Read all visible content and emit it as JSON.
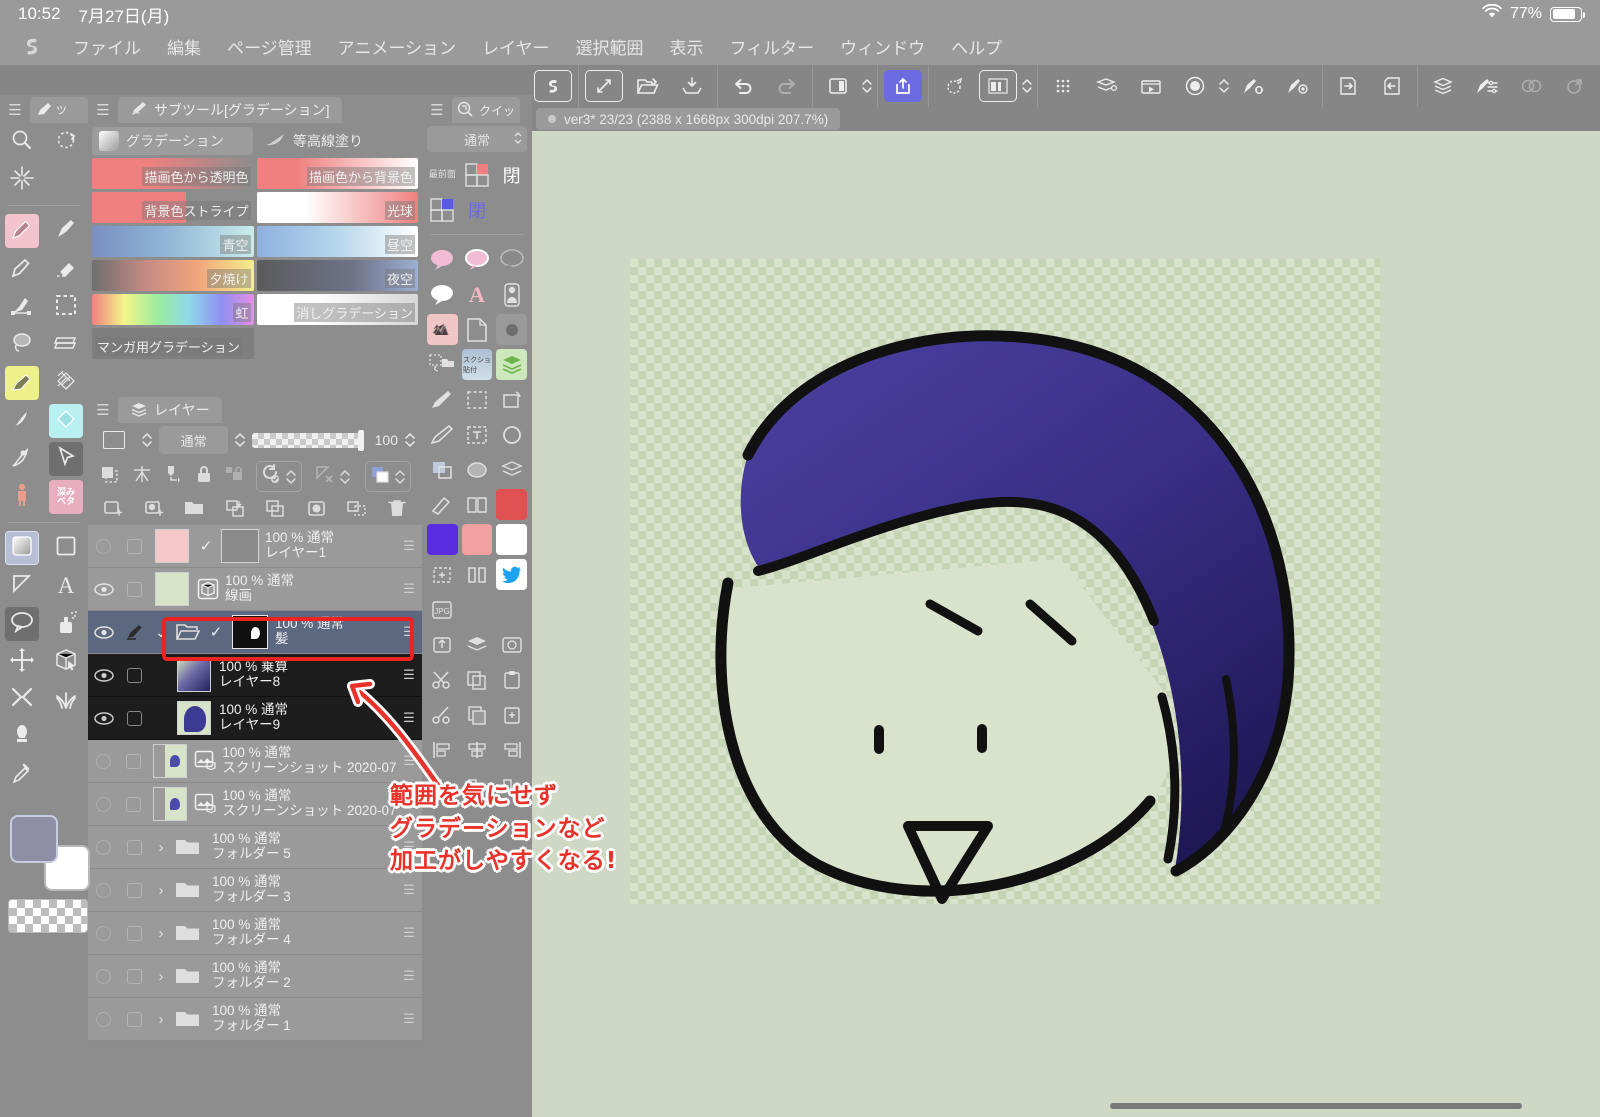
{
  "status_bar": {
    "time": "10:52",
    "date": "7月27日(月)",
    "wifi_icon": "wifi-icon",
    "battery_percent": "77%",
    "battery_icon": "battery-icon"
  },
  "menu_bar": {
    "app_logo": "clip-studio-logo",
    "items": [
      {
        "label": "ファイル"
      },
      {
        "label": "編集"
      },
      {
        "label": "ページ管理"
      },
      {
        "label": "アニメーション"
      },
      {
        "label": "レイヤー"
      },
      {
        "label": "選択範囲"
      },
      {
        "label": "表示"
      },
      {
        "label": "フィルター"
      },
      {
        "label": "ウィンドウ"
      },
      {
        "label": "ヘルプ"
      }
    ]
  },
  "command_bar": {
    "buttons": [
      {
        "name": "clip-studio-mark-icon"
      },
      {
        "name": "new-canvas-icon"
      },
      {
        "name": "open-file-icon"
      },
      {
        "name": "save-icon"
      },
      {
        "name": "undo-icon"
      },
      {
        "name": "redo-icon"
      },
      {
        "name": "layout-toggle-icon"
      },
      {
        "name": "share-icon",
        "active": true
      },
      {
        "name": "animation-onion-icon"
      },
      {
        "name": "timeline-icon"
      },
      {
        "name": "grid-dots-icon"
      },
      {
        "name": "layer-settings-icon"
      },
      {
        "name": "movie-export-icon"
      },
      {
        "name": "canvas-rotate-icon"
      },
      {
        "name": "brush-settings-icon"
      },
      {
        "name": "brush-size-icon"
      },
      {
        "name": "page-next-icon"
      },
      {
        "name": "page-prev-icon"
      },
      {
        "name": "layers-icon"
      },
      {
        "name": "sub-tool-detail-icon"
      },
      {
        "name": "link-icon"
      },
      {
        "name": "link-out-icon"
      }
    ]
  },
  "tool_palette": {
    "tab_label": "ツ",
    "tab_icon": "pen-icon",
    "menu_icon": "hamburger-icon",
    "tools": [
      {
        "name": "magnifier-icon",
        "highlight": ""
      },
      {
        "name": "rotate-canvas-icon",
        "highlight": ""
      },
      {
        "name": "magic-wand-sparkle-icon",
        "highlight": ""
      },
      {
        "name": "pen-icon",
        "highlight": "#f3c4cd"
      },
      {
        "name": "airbrush-icon",
        "highlight": ""
      },
      {
        "name": "pencil-icon",
        "highlight": ""
      },
      {
        "name": "eraser-icon",
        "highlight": ""
      },
      {
        "name": "figure-tool-icon",
        "highlight": ""
      },
      {
        "name": "selection-rect-icon",
        "highlight": ""
      },
      {
        "name": "lasso-icon",
        "highlight": ""
      },
      {
        "name": "perspective-ruler-icon",
        "highlight": ""
      },
      {
        "name": "marker-icon",
        "highlight": "#eef089"
      },
      {
        "name": "texture-icon",
        "highlight": ""
      },
      {
        "name": "blend-icon",
        "highlight": ""
      },
      {
        "name": "fill-bucket-icon",
        "highlight": "#b9f0f2"
      },
      {
        "name": "watercolor-icon",
        "highlight": ""
      },
      {
        "name": "object-select-icon",
        "highlight": "#6f6f6f"
      },
      {
        "name": "figure-model-icon",
        "highlight": ""
      },
      {
        "name": "decoration-icon",
        "highlight": "#e8aec0"
      },
      {
        "name": "gradient-icon",
        "highlight": "#b7bfd6"
      },
      {
        "name": "shape-square-icon",
        "highlight": ""
      },
      {
        "name": "ruler-icon",
        "highlight": ""
      },
      {
        "name": "text-icon",
        "highlight": ""
      },
      {
        "name": "balloon-icon",
        "highlight": "#6f6f6f"
      },
      {
        "name": "spray-icon",
        "highlight": ""
      },
      {
        "name": "move-icon",
        "highlight": ""
      },
      {
        "name": "operation-3d-icon",
        "highlight": ""
      },
      {
        "name": "correct-line-icon",
        "highlight": ""
      },
      {
        "name": "grass-icon",
        "highlight": ""
      },
      {
        "name": "stamp-icon",
        "highlight": ""
      },
      {
        "name": "eyedropper-icon",
        "highlight": ""
      }
    ],
    "colors": {
      "foreground": "#8e8ea6",
      "background": "#ffffff",
      "transparent_label": "transparent-color-swatch"
    }
  },
  "sub_tool_panel": {
    "menu_icon": "hamburger-icon",
    "tab_icon": "sub-tool-icon",
    "tab_label": "サブツール[グラデーション]",
    "group_tabs": [
      {
        "label": "グラデーション",
        "icon": "gradient-square-icon",
        "active": true
      },
      {
        "label": "等高線塗り",
        "icon": "contour-fill-icon",
        "active": false
      }
    ],
    "gradients": [
      {
        "label": "描画色から透明色",
        "css": "linear-gradient(90deg,#f08080 0%,#f08080 35%,rgba(240,128,128,0) 100%)"
      },
      {
        "label": "描画色から背景色",
        "css": "linear-gradient(90deg,#f08080 0%,#f08080 25%,#ffffff 100%)"
      },
      {
        "label": "背景色ストライプ",
        "css": "linear-gradient(90deg,#f08080 0%,#f08080 58%,#8d8d8d 58%,#8d8d8d 100%)"
      },
      {
        "label": "光球",
        "css": "linear-gradient(90deg,#ffffff 0%,#ffffff 30%,#f08080 100%)"
      },
      {
        "label": "青空",
        "css": "linear-gradient(90deg,#7b8fc2 0%,#8fb4d6 45%,#c9ecea 100%)"
      },
      {
        "label": "昼空",
        "css": "linear-gradient(90deg,#8fb0de 0%,#b6d7ec 50%,#ffffff 100%)"
      },
      {
        "label": "夕焼け",
        "css": "linear-gradient(90deg,#6f6f6f 0%,#c98c84 35%,#f0a47c 65%,#f5ef8a 100%)"
      },
      {
        "label": "夜空",
        "css": "linear-gradient(90deg,#5b5b5b 0%,#6f7388 60%,#9db0d4 100%)"
      },
      {
        "label": "虹",
        "css": "linear-gradient(90deg,#f08080,#f5f58a,#9ced9c,#8fd9ea,#8f8ff0,#e58fe5)"
      },
      {
        "label": "消しグラデーション",
        "css": "linear-gradient(90deg,#ffffff 0%,#ffffff 35%,#d6d6d6 100%)"
      },
      {
        "label": "マンガ用グラデーション",
        "css": "linear-gradient(90deg,#7f7f7f,#7f7f7f)"
      }
    ]
  },
  "quick_access_panel": {
    "menu_icon": "hamburger-icon",
    "tab_icon": "quick-access-icon",
    "tab_label": "クイッ",
    "blend_mode": "通常",
    "items": [
      {
        "name": "bring-to-front-icon",
        "label": "最前面"
      },
      {
        "name": "quad-red-icon",
        "label": ""
      },
      {
        "name": "close-kanji-icon",
        "label": "閉"
      },
      {
        "name": "quad-purple-icon",
        "label": ""
      },
      {
        "name": "close-kanji-purple-icon",
        "label": "閉"
      },
      {
        "name": "balloon-pink-filled-icon",
        "label": ""
      },
      {
        "name": "balloon-pink-outline-icon",
        "label": ""
      },
      {
        "name": "balloon-gray-icon",
        "label": ""
      },
      {
        "name": "balloon-white-icon",
        "label": ""
      },
      {
        "name": "text-a-pink-icon",
        "label": ""
      },
      {
        "name": "figure-pin-icon",
        "label": ""
      },
      {
        "name": "texture-pink-icon",
        "label": ""
      },
      {
        "name": "page-corner-icon",
        "label": ""
      },
      {
        "name": "circle-gray-icon",
        "label": ""
      },
      {
        "name": "select-to-folder-icon",
        "label": ""
      },
      {
        "name": "screenshot-paste-icon",
        "label": ""
      },
      {
        "name": "layers-green-icon",
        "label": ""
      },
      {
        "name": "pen-line-icon",
        "label": ""
      },
      {
        "name": "marquee-icon",
        "label": ""
      },
      {
        "name": "rotate-select-icon",
        "label": ""
      },
      {
        "name": "brush-icon",
        "label": ""
      },
      {
        "name": "text-box-icon",
        "label": ""
      },
      {
        "name": "circle-outline-icon",
        "label": ""
      },
      {
        "name": "clip-mask-icon",
        "label": ""
      },
      {
        "name": "mask-icon",
        "label": ""
      },
      {
        "name": "layers-stack-icon",
        "label": ""
      },
      {
        "name": "ruler-snap-icon",
        "label": ""
      },
      {
        "name": "flip-icon",
        "label": ""
      },
      {
        "name": "red-swatch-icon",
        "label": ""
      },
      {
        "name": "purple-swatch-icon",
        "label": ""
      },
      {
        "name": "pink-swatch-icon",
        "label": ""
      },
      {
        "name": "white-swatch-icon",
        "label": ""
      },
      {
        "name": "transform-icon",
        "label": ""
      },
      {
        "name": "split-icon",
        "label": ""
      },
      {
        "name": "twitter-icon",
        "label": ""
      },
      {
        "name": "jpeg-export-icon",
        "label": "JPG"
      },
      {
        "name": "export-icon",
        "label": ""
      },
      {
        "name": "layers-small-icon",
        "label": ""
      },
      {
        "name": "photo-import-icon",
        "label": ""
      },
      {
        "name": "scissors-icon",
        "label": ""
      },
      {
        "name": "copy-icon",
        "label": ""
      },
      {
        "name": "paste-icon",
        "label": ""
      },
      {
        "name": "cut-icon",
        "label": ""
      },
      {
        "name": "duplicate-icon",
        "label": ""
      },
      {
        "name": "paste-2-icon",
        "label": ""
      },
      {
        "name": "align-left-icon",
        "label": ""
      },
      {
        "name": "align-center-icon",
        "label": ""
      },
      {
        "name": "align-right-icon",
        "label": ""
      },
      {
        "name": "distribute-left-icon",
        "label": ""
      },
      {
        "name": "distribute-center-icon",
        "label": ""
      },
      {
        "name": "distribute-right-icon",
        "label": ""
      }
    ]
  },
  "layer_panel": {
    "menu_icon": "hamburger-icon",
    "tab_icon": "layers-icon",
    "tab_label": "レイヤー",
    "blend_mode": "通常",
    "opacity": "100",
    "toolbar_row1": [
      {
        "name": "clip-to-layer-below-icon"
      },
      {
        "name": "ruler-all-layers-icon"
      },
      {
        "name": "reference-layer-icon"
      },
      {
        "name": "lock-layer-icon"
      },
      {
        "name": "lock-transparent-pixel-icon"
      },
      {
        "name": "auto-action-icon"
      },
      {
        "name": "mask-disable-icon"
      },
      {
        "name": "layer-color-icon"
      }
    ],
    "toolbar_row2": [
      {
        "name": "new-raster-layer-icon"
      },
      {
        "name": "new-tone-layer-icon"
      },
      {
        "name": "new-folder-icon"
      },
      {
        "name": "merge-down-icon"
      },
      {
        "name": "duplicate-layer-icon"
      },
      {
        "name": "layer-mask-icon"
      },
      {
        "name": "combine-icon"
      },
      {
        "name": "delete-layer-icon"
      }
    ],
    "layers": [
      {
        "visible": false,
        "locked": false,
        "opacity": "100 %",
        "blend": "通常",
        "name": "レイヤー1",
        "thumb": "#f5c9c9",
        "state": "normal",
        "clip_check": true,
        "type": "raster",
        "sub_icon": "clip-thumb"
      },
      {
        "visible": true,
        "locked": false,
        "opacity": "100 %",
        "blend": "通常",
        "name": "線画",
        "thumb": "#d7e4c9",
        "state": "normal",
        "clip_check": false,
        "type": "raster",
        "sub_icon": "reference-cube-icon"
      },
      {
        "visible": true,
        "locked": false,
        "opacity": "100 %",
        "blend": "通常",
        "name": "髪",
        "thumb": "#1a1a1a",
        "state": "selected",
        "clip_check": true,
        "type": "folder",
        "sub_icon": "mask-thumb"
      },
      {
        "visible": true,
        "locked": false,
        "opacity": "100 %",
        "blend": "乗算",
        "name": "レイヤー8",
        "thumb": "#2d2a72",
        "state": "dark",
        "clip_check": false,
        "type": "raster",
        "sub_icon": "",
        "highlighted": true
      },
      {
        "visible": true,
        "locked": false,
        "opacity": "100 %",
        "blend": "通常",
        "name": "レイヤー9",
        "thumb": "#3b3b93",
        "state": "dark",
        "clip_check": false,
        "type": "raster",
        "sub_icon": ""
      },
      {
        "visible": false,
        "locked": false,
        "opacity": "100 %",
        "blend": "通常",
        "name": "スクリーンショット 2020-07",
        "thumb": "#b9c3b0",
        "state": "normal",
        "clip_check": false,
        "type": "image",
        "sub_icon": "image-material-icon"
      },
      {
        "visible": false,
        "locked": false,
        "opacity": "100 %",
        "blend": "通常",
        "name": "スクリーンショット 2020-07",
        "thumb": "#b9c3b0",
        "state": "normal",
        "clip_check": false,
        "type": "image",
        "sub_icon": "image-material-icon"
      },
      {
        "visible": false,
        "locked": false,
        "opacity": "100 %",
        "blend": "通常",
        "name": "フォルダー 5",
        "thumb": "",
        "state": "normal",
        "clip_check": false,
        "type": "folder-collapsed",
        "sub_icon": ""
      },
      {
        "visible": false,
        "locked": false,
        "opacity": "100 %",
        "blend": "通常",
        "name": "フォルダー 3",
        "thumb": "",
        "state": "normal",
        "clip_check": false,
        "type": "folder-collapsed",
        "sub_icon": ""
      },
      {
        "visible": false,
        "locked": false,
        "opacity": "100 %",
        "blend": "通常",
        "name": "フォルダー 4",
        "thumb": "",
        "state": "normal",
        "clip_check": false,
        "type": "folder-collapsed",
        "sub_icon": ""
      },
      {
        "visible": false,
        "locked": false,
        "opacity": "100 %",
        "blend": "通常",
        "name": "フォルダー 2",
        "thumb": "",
        "state": "normal",
        "clip_check": false,
        "type": "folder-collapsed",
        "sub_icon": ""
      },
      {
        "visible": false,
        "locked": false,
        "opacity": "100 %",
        "blend": "通常",
        "name": "フォルダー 1",
        "thumb": "",
        "state": "normal",
        "clip_check": false,
        "type": "folder-collapsed",
        "sub_icon": ""
      }
    ]
  },
  "canvas": {
    "tab_title": "ver3* 23/23 (2388 x 1668px 300dpi 207.7%)",
    "artwork_description": "girl-face-illustration",
    "hair_color": "#3a2f86",
    "line_color": "#111111",
    "transparent_bg_color": "#d9e3cb"
  },
  "annotation": {
    "line1": "範囲を気にせず",
    "line2": "グラデーションなど",
    "line3": "加工がしやすくなる!",
    "arrow": "curved-arrow-to-layer8",
    "color": "#e8322a"
  }
}
